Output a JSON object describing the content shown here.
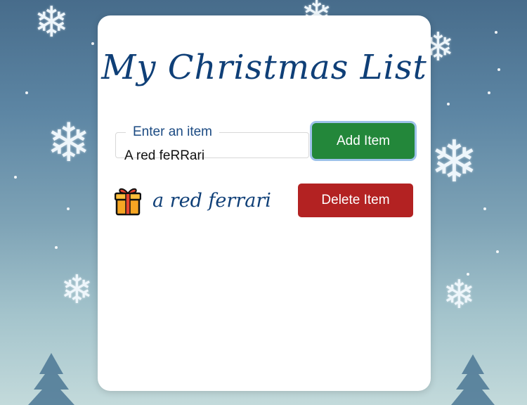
{
  "page": {
    "title": "My Christmas List",
    "input": {
      "legend": "Enter an item",
      "value": "A red feRRari"
    },
    "add_button": "Add Item",
    "items": [
      {
        "icon": "gift-icon",
        "text": "a red ferrari",
        "delete_label": "Delete Item"
      }
    ]
  },
  "colors": {
    "title": "#0f3f77",
    "add_button": "#23873a",
    "delete_button": "#b32222",
    "background_top": "#476c8b",
    "background_bottom": "#c3dadb"
  }
}
